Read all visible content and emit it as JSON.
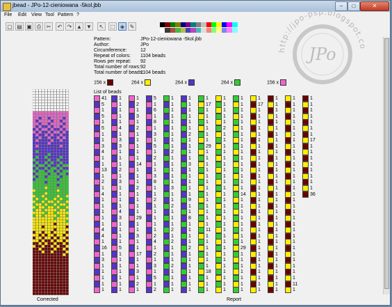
{
  "window": {
    "title": "jbead - JPo-12-cieniowana -5kol.jbb",
    "min": "–",
    "max": "□",
    "close": "✕"
  },
  "menu": [
    "File",
    "Edit",
    "View",
    "Tool",
    "Pattern",
    "?"
  ],
  "toolbar": {
    "icons": [
      "new-icon",
      "open-icon",
      "save-icon",
      "print-icon",
      "cut-icon",
      "undo-icon",
      "redo-icon",
      "arrow-up-icon",
      "arrow-down-icon",
      "pointer-icon",
      "select-rect-icon",
      "fill-icon",
      "pipette-icon"
    ],
    "palette": [
      "#000000",
      "#7a0000",
      "#008000",
      "#808000",
      "#000080",
      "#800080",
      "#008080",
      "#808080",
      "#c0c0c0",
      "#ff0000",
      "#00ff00",
      "#ffff00",
      "#0000ff",
      "#ff00ff",
      "#00ffff",
      "#ffffff",
      "#3b3b3b",
      "#b44",
      "#4b4",
      "#bb4",
      "#44b",
      "#b4b",
      "#4bb",
      "#ddd",
      "#ff8080",
      "#80ff80",
      "#ffff80",
      "#8080ff",
      "#ff80ff",
      "#80ffff"
    ]
  },
  "info": [
    {
      "label": "Pattern:",
      "value": "JPo-12-cieniowana -5kol.jbb"
    },
    {
      "label": "Author:",
      "value": "JPo"
    },
    {
      "label": "Circumference:",
      "value": "12"
    },
    {
      "label": "Repeat of colors:",
      "value": "1104 beads"
    },
    {
      "label": "Rows per repeat:",
      "value": "92"
    },
    {
      "label": "Total number of rows:",
      "value": "92"
    },
    {
      "label": "Total number of beads:",
      "value": "1104 beads"
    }
  ],
  "legend": [
    {
      "count": "156 x",
      "color": "#6b0000"
    },
    {
      "count": "264 x",
      "color": "#ffee00"
    },
    {
      "count": "264 x",
      "color": "#5533cc"
    },
    {
      "count": "264 x",
      "color": "#33cc33"
    },
    {
      "count": "156 x",
      "color": "#ee66cc"
    }
  ],
  "list_header": "List of beads",
  "colors": {
    "M": "#ee66cc",
    "P": "#5533cc",
    "G": "#33cc33",
    "Y": "#ffee00",
    "R": "#6b0000"
  },
  "bead_columns": [
    {
      "c": [
        "M",
        "P",
        "M",
        "P",
        "M",
        "P",
        "M",
        "P",
        "M",
        "P",
        "M",
        "P",
        "M",
        "P",
        "M",
        "P",
        "M",
        "P",
        "M",
        "P",
        "M",
        "P",
        "M",
        "P",
        "M",
        "P",
        "M",
        "P",
        "M",
        "P",
        "M",
        "P",
        "M"
      ],
      "n": [
        "41",
        "5",
        "1",
        "5",
        "1",
        "5",
        "1",
        "1",
        "3",
        "4",
        "1",
        "1",
        "13",
        "1",
        "2",
        "1",
        "4",
        "1",
        "1",
        "1",
        "1",
        "1",
        "4",
        "4",
        "1",
        "16",
        "1",
        "3",
        "1",
        "1",
        "1",
        "1",
        "1"
      ]
    },
    {
      "c": [
        "P",
        "M",
        "P",
        "M",
        "P",
        "M",
        "P",
        "M",
        "P",
        "M",
        "P",
        "M",
        "P",
        "M",
        "P",
        "M",
        "P",
        "M",
        "P",
        "M",
        "P",
        "M",
        "P",
        "M",
        "P",
        "M",
        "P",
        "M",
        "P",
        "M",
        "P",
        "M",
        "P"
      ],
      "n": [
        "1",
        "1",
        "1",
        "1",
        "1",
        "4",
        "1",
        "3",
        "3",
        "1",
        "1",
        "1",
        "2",
        "1",
        "3",
        "1",
        "1",
        "1",
        "1",
        "4",
        "3",
        "1",
        "1",
        "1",
        "1",
        "5",
        "1",
        "1",
        "1",
        "1",
        "1",
        "1",
        "1"
      ]
    },
    {
      "c": [
        "M",
        "P",
        "M",
        "P",
        "M",
        "P",
        "M",
        "P",
        "M",
        "P",
        "M",
        "P",
        "M",
        "P",
        "M",
        "P",
        "M",
        "P",
        "M",
        "P",
        "M",
        "P",
        "M",
        "P",
        "M",
        "P",
        "M",
        "P",
        "M",
        "P",
        "M",
        "P",
        "M"
      ],
      "n": [
        "1",
        "2",
        "1",
        "3",
        "1",
        "2",
        "1",
        "1",
        "1",
        "1",
        "1",
        "14",
        "1",
        "1",
        "1",
        "2",
        "1",
        "1",
        "1",
        "1",
        "29",
        "1",
        "1",
        "3",
        "1",
        "1",
        "17",
        "1",
        "1",
        "3",
        "1",
        "2",
        "1"
      ]
    },
    {
      "c": [
        "P",
        "M",
        "P",
        "M",
        "P",
        "M",
        "P",
        "M",
        "P",
        "M",
        "P",
        "M",
        "P",
        "M",
        "P",
        "M",
        "P",
        "M",
        "P",
        "M",
        "P",
        "M",
        "P",
        "M",
        "P",
        "M",
        "P",
        "M",
        "P",
        "M",
        "P",
        "M",
        "P"
      ],
      "n": [
        "5",
        "1",
        "6",
        "1",
        "8",
        "1",
        "3",
        "1",
        "5",
        "1",
        "2",
        "1",
        "1",
        "3",
        "8",
        "1",
        "1",
        "2",
        "1",
        "1",
        "1",
        "1",
        "1",
        "2",
        "4",
        "1",
        "2",
        "1",
        "3",
        "1",
        "5",
        "1",
        "2"
      ]
    },
    {
      "c": [
        "G",
        "P",
        "G",
        "P",
        "G",
        "P",
        "G",
        "P",
        "G",
        "P",
        "G",
        "P",
        "G",
        "P",
        "G",
        "P",
        "G",
        "P",
        "G",
        "P",
        "G",
        "P",
        "G",
        "P",
        "G",
        "P",
        "G",
        "P",
        "G",
        "P",
        "G",
        "P",
        "G"
      ],
      "n": [
        "1",
        "1",
        "1",
        "1",
        "1",
        "1",
        "1",
        "1",
        "1",
        "2",
        "1",
        "1",
        "1",
        "1",
        "1",
        "3",
        "1",
        "1",
        "2",
        "1",
        "1",
        "1",
        "2",
        "1",
        "2",
        "1",
        "1",
        "1",
        "2",
        "1",
        "1",
        "1",
        "1"
      ]
    },
    {
      "c": [
        "P",
        "G",
        "P",
        "G",
        "P",
        "G",
        "P",
        "G",
        "P",
        "G",
        "P",
        "G",
        "P",
        "G",
        "P",
        "G",
        "P",
        "G",
        "P",
        "G",
        "P",
        "G",
        "P",
        "G",
        "P",
        "G",
        "P",
        "G",
        "P",
        "G",
        "P",
        "G",
        "P"
      ],
      "n": [
        "1",
        "1",
        "1",
        "1",
        "1",
        "1",
        "2",
        "1",
        "1",
        "1",
        "1",
        "3",
        "1",
        "1",
        "1",
        "1",
        "1",
        "9",
        "1",
        "1",
        "8",
        "1",
        "1",
        "1",
        "1",
        "2",
        "1",
        "1",
        "1",
        "1",
        "1",
        "1",
        "1"
      ]
    },
    {
      "c": [
        "G",
        "Y",
        "G",
        "Y",
        "G",
        "Y",
        "G",
        "Y",
        "G",
        "Y",
        "G",
        "Y",
        "G",
        "Y",
        "G",
        "Y",
        "G",
        "Y",
        "G",
        "Y",
        "G",
        "Y",
        "G",
        "Y",
        "G",
        "Y",
        "G",
        "Y",
        "G",
        "Y",
        "G",
        "Y",
        "G"
      ],
      "n": [
        "1",
        "17",
        "1",
        "1",
        "1",
        "1",
        "1",
        "1",
        "29",
        "1",
        "1",
        "1",
        "1",
        "1",
        "1",
        "1",
        "1",
        "1",
        "1",
        "1",
        "1",
        "1",
        "11",
        "1",
        "1",
        "1",
        "1",
        "1",
        "1",
        "18",
        "1",
        "1",
        "1"
      ]
    },
    {
      "c": [
        "Y",
        "G",
        "Y",
        "G",
        "Y",
        "G",
        "Y",
        "G",
        "Y",
        "G",
        "Y",
        "G",
        "Y",
        "G",
        "Y",
        "G",
        "Y",
        "G",
        "Y",
        "G",
        "Y",
        "G",
        "Y",
        "G",
        "Y",
        "G",
        "Y",
        "G",
        "Y",
        "G",
        "Y",
        "G",
        "Y"
      ],
      "n": [
        "1",
        "1",
        "1",
        "1",
        "1",
        "2",
        "1",
        "1",
        "1",
        "1",
        "1",
        "1",
        "1",
        "1",
        "1",
        "1",
        "1",
        "1",
        "1",
        "1",
        "1",
        "1",
        "1",
        "1",
        "1",
        "1",
        "1",
        "1",
        "1",
        "1",
        "1",
        "1",
        "1"
      ]
    },
    {
      "c": [
        "G",
        "Y",
        "G",
        "Y",
        "G",
        "Y",
        "G",
        "Y",
        "G",
        "Y",
        "G",
        "Y",
        "G",
        "Y",
        "G",
        "Y",
        "G",
        "Y",
        "G",
        "Y",
        "G",
        "Y",
        "G",
        "Y",
        "G",
        "Y",
        "G",
        "Y",
        "G",
        "Y",
        "G",
        "Y",
        "G"
      ],
      "n": [
        "1",
        "1",
        "1",
        "1",
        "1",
        "1",
        "1",
        "1",
        "1",
        "1",
        "1",
        "1",
        "1",
        "1",
        "1",
        "1",
        "14",
        "1",
        "1",
        "1",
        "1",
        "1",
        "1",
        "1",
        "1",
        "29",
        "1",
        "1",
        "1",
        "1",
        "1",
        "1",
        "1"
      ]
    },
    {
      "c": [
        "Y",
        "R",
        "Y",
        "R",
        "Y",
        "R",
        "Y",
        "R",
        "Y",
        "R",
        "Y",
        "R",
        "Y",
        "R",
        "Y",
        "R",
        "Y",
        "R",
        "Y",
        "R",
        "Y",
        "R",
        "Y",
        "R",
        "Y",
        "R",
        "Y",
        "R",
        "Y",
        "R",
        "Y",
        "R",
        "Y"
      ],
      "n": [
        "1",
        "17",
        "1",
        "1",
        "1",
        "1",
        "1",
        "1",
        "1",
        "1",
        "1",
        "1",
        "1",
        "1",
        "1",
        "1",
        "1",
        "1",
        "1",
        "1",
        "1",
        "1",
        "1",
        "1",
        "1",
        "1",
        "1",
        "1",
        "1",
        "1",
        "1",
        "1",
        "1"
      ]
    },
    {
      "c": [
        "R",
        "Y",
        "R",
        "Y",
        "R",
        "Y",
        "R",
        "Y",
        "R",
        "Y",
        "R",
        "Y",
        "R",
        "Y",
        "R",
        "Y",
        "R",
        "Y",
        "R",
        "Y",
        "R",
        "Y",
        "R",
        "Y",
        "R",
        "Y",
        "R",
        "Y",
        "R",
        "Y",
        "R",
        "Y",
        "R"
      ],
      "n": [
        "1",
        "1",
        "1",
        "1",
        "1",
        "1",
        "1",
        "1",
        "1",
        "1",
        "1",
        "1",
        "1",
        "1",
        "1",
        "1",
        "1",
        "1",
        "1",
        "1",
        "1",
        "1",
        "1",
        "1",
        "1",
        "1",
        "1",
        "1",
        "1",
        "1",
        "1",
        "1",
        "1"
      ]
    },
    {
      "c": [
        "Y",
        "R",
        "Y",
        "R",
        "Y",
        "R",
        "Y",
        "R",
        "Y",
        "R",
        "Y",
        "R",
        "Y",
        "R",
        "Y",
        "R",
        "Y",
        "R",
        "Y",
        "R",
        "Y",
        "R",
        "Y",
        "R",
        "Y",
        "R",
        "Y",
        "R",
        "Y",
        "R",
        "Y",
        "R",
        "Y"
      ],
      "n": [
        "1",
        "1",
        "1",
        "1",
        "1",
        "1",
        "1",
        "1",
        "1",
        "1",
        "1",
        "1",
        "1",
        "1",
        "1",
        "1",
        "1",
        "1",
        "1",
        "1",
        "1",
        "1",
        "1",
        "1",
        "1",
        "1",
        "1",
        "1",
        "1",
        "1",
        "1",
        "11",
        "1"
      ]
    },
    {
      "c": [
        "R",
        "Y",
        "R",
        "Y",
        "R",
        "Y",
        "R",
        "Y",
        "R",
        "Y",
        "R",
        "Y",
        "R",
        "Y",
        "R",
        "Y",
        "R"
      ],
      "n": [
        "1",
        "1",
        "1",
        "1",
        "1",
        "1",
        "1",
        "17",
        "1",
        "1",
        "1",
        "1",
        "1",
        "1",
        "1",
        "1",
        "36"
      ]
    }
  ],
  "footer": {
    "left": "Corrected",
    "center": "Report"
  },
  "watermark": {
    "text": "http://jpo-psp.blogspot.com",
    "monogram": "JPo"
  }
}
